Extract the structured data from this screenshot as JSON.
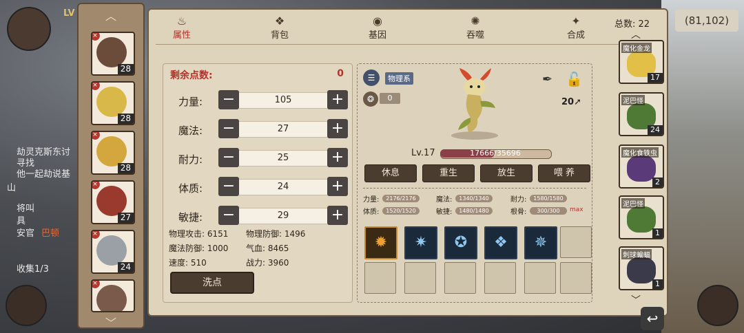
{
  "background": {
    "coords": "(81,102)",
    "left_texts": [
      "LV",
      "劫灵克斯东讨",
      "寻找",
      "他一起劫说基",
      "山",
      "将叫",
      "具",
      "安官",
      "巴顿",
      "收集1/3"
    ]
  },
  "tabs": [
    {
      "label": "属性",
      "icon": "fire-icon",
      "active": true
    },
    {
      "label": "背包",
      "icon": "bag-icon",
      "active": false
    },
    {
      "label": "基因",
      "icon": "dna-icon",
      "active": false
    },
    {
      "label": "吞噬",
      "icon": "devour-icon",
      "active": false
    },
    {
      "label": "合成",
      "icon": "fusion-icon",
      "active": false
    }
  ],
  "left_pets": [
    {
      "level": "28",
      "color": "#6b4b3a"
    },
    {
      "level": "28",
      "color": "#d9b84a"
    },
    {
      "level": "28",
      "color": "#d3a63e"
    },
    {
      "level": "27",
      "color": "#9a3a2e"
    },
    {
      "level": "24",
      "color": "#9aa0a6"
    },
    {
      "level": "",
      "color": "#7a5a4a"
    }
  ],
  "attributes": {
    "remain_label": "剩余点数:",
    "remain_value": "0",
    "stats": [
      {
        "name": "力量:",
        "value": "105"
      },
      {
        "name": "魔法:",
        "value": "27"
      },
      {
        "name": "耐力:",
        "value": "25"
      },
      {
        "name": "体质:",
        "value": "24"
      },
      {
        "name": "敏捷:",
        "value": "29"
      }
    ],
    "derived": [
      "物理攻击: 6151",
      "物理防御: 1496",
      "魔法防御: 1000",
      "气血: 8465",
      "速度: 510",
      "战力: 3960"
    ],
    "wash_label": "洗点"
  },
  "detail": {
    "type_tag": "物理系",
    "paw_value": "0",
    "level20": "20",
    "level_label": "Lv.17",
    "hp_text": "17666/35696",
    "hp_fraction": 0.495,
    "actions": [
      "休息",
      "重生",
      "放生",
      "喂 养"
    ],
    "mini_stats": [
      {
        "label": "力量:",
        "value": "2176/2176"
      },
      {
        "label": "魔法:",
        "value": "1340/1340"
      },
      {
        "label": "耐力:",
        "value": "1580/1580"
      },
      {
        "label": "体质:",
        "value": "1520/1520"
      },
      {
        "label": "敏捷:",
        "value": "1480/1480"
      },
      {
        "label": "根骨:",
        "value": "300/300"
      }
    ],
    "max_label": "max"
  },
  "right_list": {
    "total_label": "总数: 22",
    "items": [
      {
        "name": "魔化金龙",
        "level": "17",
        "color": "#e2c047"
      },
      {
        "name": "泥巴怪",
        "level": "24",
        "color": "#4f7a36"
      },
      {
        "name": "魔化食铁虫",
        "level": "2",
        "color": "#5b3a7a"
      },
      {
        "name": "泥巴怪",
        "level": "1",
        "color": "#4f7a36"
      },
      {
        "name": "刺球蝙蝠",
        "level": "1",
        "color": "#3a3a4a"
      }
    ]
  }
}
